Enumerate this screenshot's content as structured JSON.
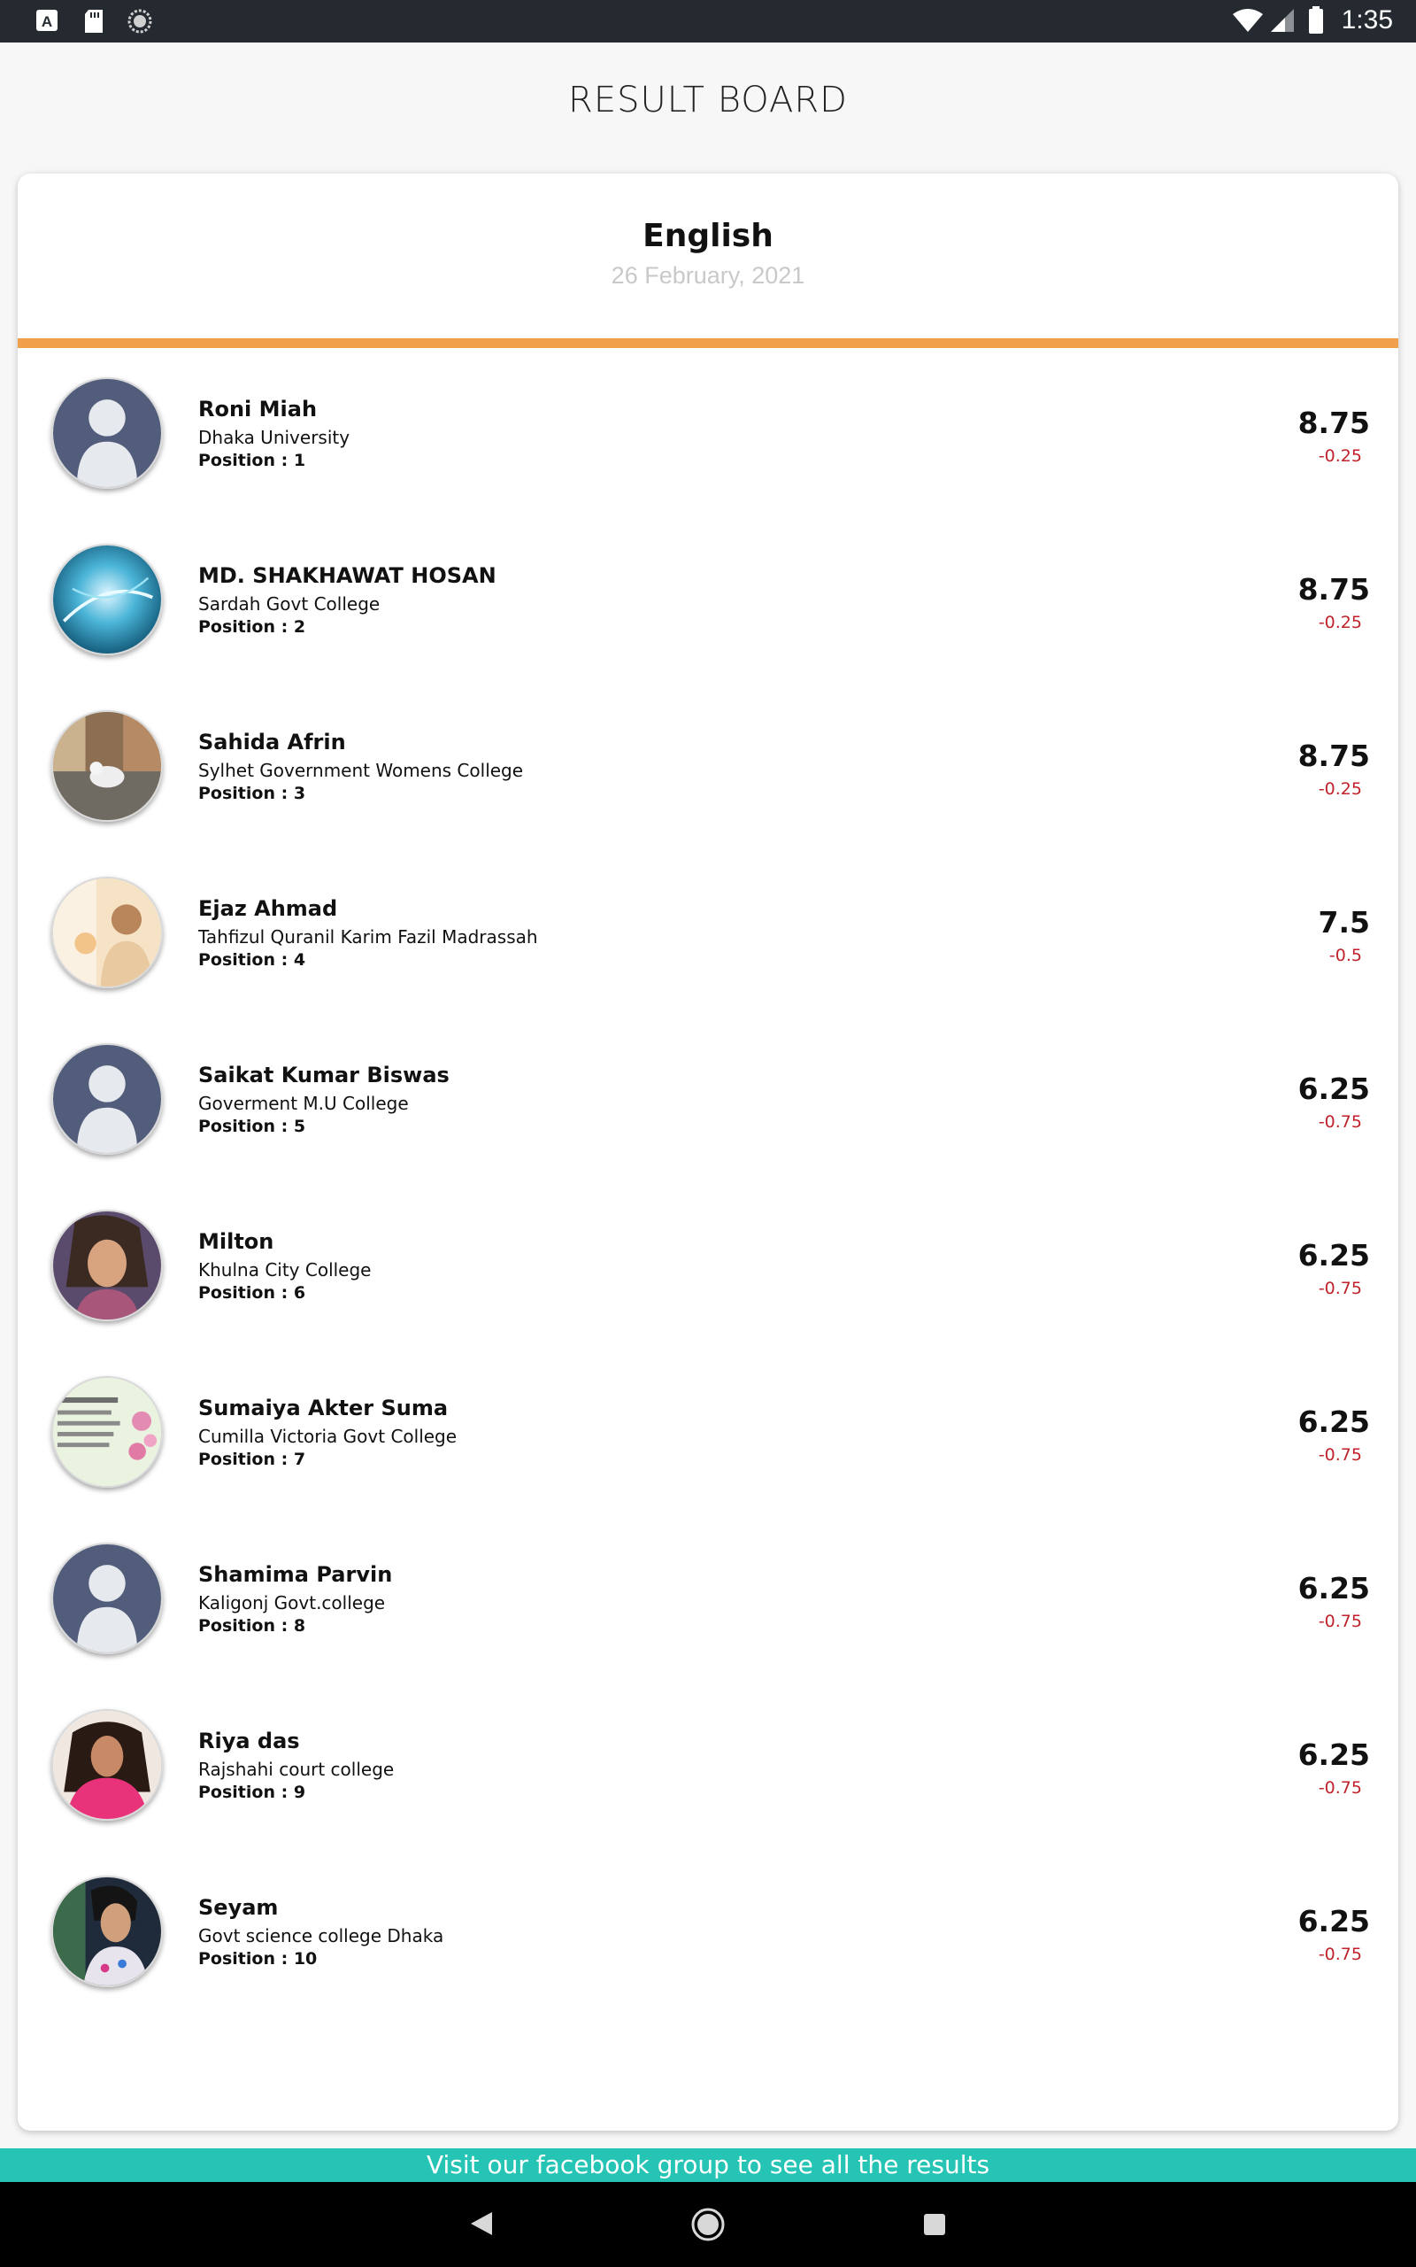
{
  "status_bar": {
    "time": "1:35",
    "left_icons": [
      "keyboard-a-icon",
      "sd-card-icon",
      "sync-circle-icon"
    ],
    "right_icons": [
      "wifi-icon",
      "cell-signal-icon",
      "battery-icon"
    ]
  },
  "page": {
    "title": "RESULT BOARD"
  },
  "card": {
    "subject": "English",
    "date": "26 February, 2021",
    "accent_color": "#f0a04b"
  },
  "results": [
    {
      "name": "Roni Miah",
      "college": "Dhaka University",
      "position_label": "Position : ",
      "position": "1",
      "score": "8.75",
      "delta": "-0.25",
      "avatar": "default-user-avatar"
    },
    {
      "name": "MD. SHAKHAWAT HOSAN",
      "college": "Sardah Govt College",
      "position_label": "Position : ",
      "position": "2",
      "score": "8.75",
      "delta": "-0.25",
      "avatar": "blue-abstract-avatar"
    },
    {
      "name": "Sahida Afrin",
      "college": "Sylhet Government Womens College",
      "position_label": "Position : ",
      "position": "3",
      "score": "8.75",
      "delta": "-0.25",
      "avatar": "seagull-photo-avatar"
    },
    {
      "name": "Ejaz Ahmad",
      "college": "Tahfizul Quranil Karim Fazil Madrassah",
      "position_label": "Position : ",
      "position": "4",
      "score": "7.5",
      "delta": "-0.5",
      "avatar": "person-photo-avatar"
    },
    {
      "name": "Saikat Kumar Biswas",
      "college": "Goverment M.U College",
      "position_label": "Position : ",
      "position": "5",
      "score": "6.25",
      "delta": "-0.75",
      "avatar": "default-user-avatar"
    },
    {
      "name": "Milton",
      "college": "Khulna City College",
      "position_label": "Position : ",
      "position": "6",
      "score": "6.25",
      "delta": "-0.75",
      "avatar": "person-photo-avatar"
    },
    {
      "name": "Sumaiya Akter Suma",
      "college": "Cumilla Victoria Govt College",
      "position_label": "Position : ",
      "position": "7",
      "score": "6.25",
      "delta": "-0.75",
      "avatar": "quote-image-avatar"
    },
    {
      "name": "Shamima Parvin",
      "college": "Kaligonj Govt.college",
      "position_label": "Position : ",
      "position": "8",
      "score": "6.25",
      "delta": "-0.75",
      "avatar": "default-user-avatar"
    },
    {
      "name": "Riya das",
      "college": "Rajshahi court college",
      "position_label": "Position : ",
      "position": "9",
      "score": "6.25",
      "delta": "-0.75",
      "avatar": "person-photo-avatar"
    },
    {
      "name": "Seyam",
      "college": "Govt science college Dhaka",
      "position_label": "Position : ",
      "position": "10",
      "score": "6.25",
      "delta": "-0.75",
      "avatar": "person-photo-avatar"
    }
  ],
  "footer": {
    "banner_text": "Visit our facebook group to see all the results",
    "banner_color": "#26c4b5"
  },
  "nav_bar": {
    "buttons": [
      "back-icon",
      "home-icon",
      "recents-icon"
    ]
  }
}
